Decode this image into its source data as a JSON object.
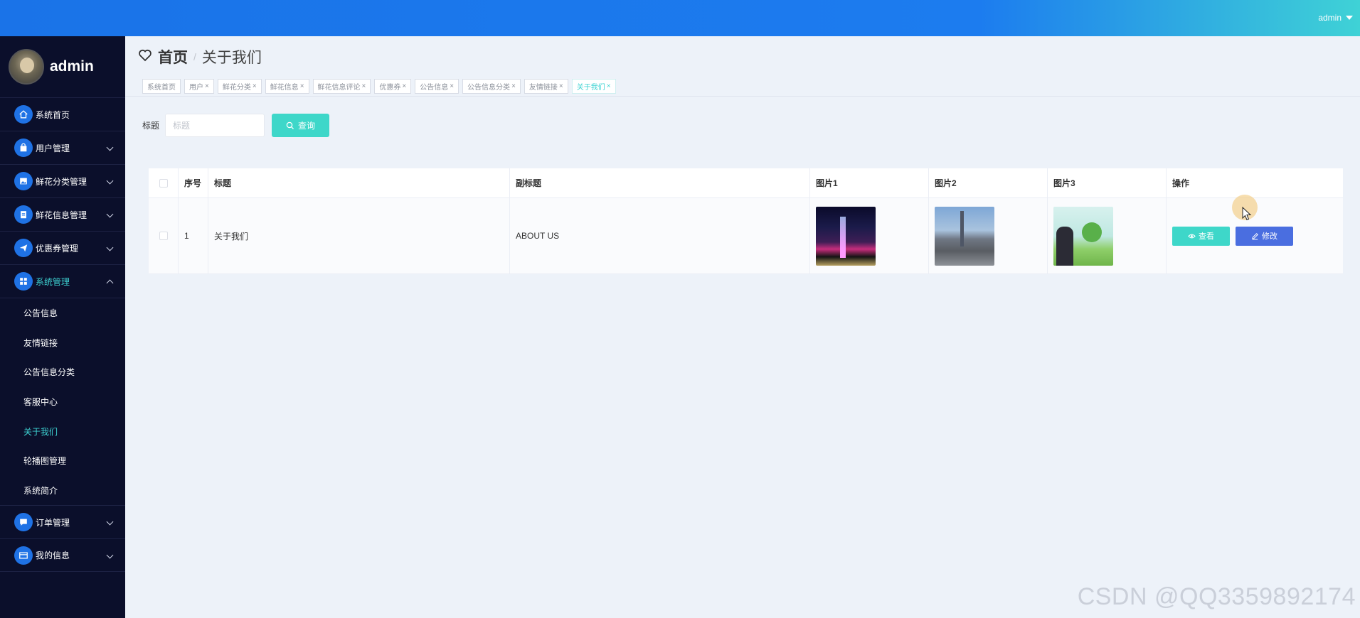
{
  "topbar": {
    "user": "admin"
  },
  "sidebar": {
    "username": "admin",
    "menu_items": [
      {
        "label": "系统首页",
        "icon": "home-icon"
      },
      {
        "label": "用户管理",
        "icon": "bag-icon"
      },
      {
        "label": "鲜花分类管理",
        "icon": "image-icon"
      },
      {
        "label": "鲜花信息管理",
        "icon": "clipboard-icon"
      },
      {
        "label": "优惠券管理",
        "icon": "send-icon"
      },
      {
        "label": "系统管理",
        "icon": "grid-icon"
      },
      {
        "label": "订单管理",
        "icon": "chat-icon"
      },
      {
        "label": "我的信息",
        "icon": "card-icon"
      }
    ],
    "submenu": [
      {
        "label": "公告信息"
      },
      {
        "label": "友情链接"
      },
      {
        "label": "公告信息分类"
      },
      {
        "label": "客服中心"
      },
      {
        "label": "关于我们"
      },
      {
        "label": "轮播图管理"
      },
      {
        "label": "系统简介"
      }
    ]
  },
  "breadcrumb": {
    "home": "首页",
    "separator": "/",
    "current": "关于我们"
  },
  "tabs": [
    {
      "label": "系统首页"
    },
    {
      "label": "用户"
    },
    {
      "label": "鲜花分类"
    },
    {
      "label": "鲜花信息"
    },
    {
      "label": "鲜花信息评论"
    },
    {
      "label": "优惠券"
    },
    {
      "label": "公告信息"
    },
    {
      "label": "公告信息分类"
    },
    {
      "label": "友情链接"
    },
    {
      "label": "关于我们"
    }
  ],
  "search": {
    "label": "标题",
    "placeholder": "标题",
    "button": "查询"
  },
  "table": {
    "headers": {
      "index": "序号",
      "title": "标题",
      "subtitle": "副标题",
      "img1": "图片1",
      "img2": "图片2",
      "img3": "图片3",
      "ops": "操作"
    },
    "rows": [
      {
        "index": "1",
        "title": "关于我们",
        "subtitle": "ABOUT US",
        "view": "查看",
        "edit": "修改"
      }
    ]
  },
  "watermark": "CSDN @QQ3359892174"
}
